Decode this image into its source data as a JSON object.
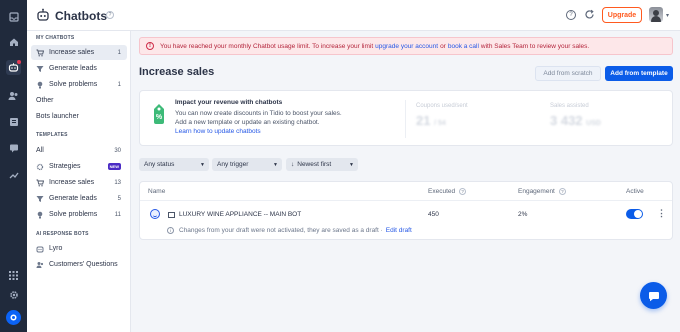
{
  "app": {
    "title": "Chatbots",
    "help_badge": "?"
  },
  "topbar": {
    "upgrade_label": "Upgrade",
    "help_label": "?"
  },
  "sidebar": {
    "my_chatbots_header": "MY CHATBOTS",
    "my_chatbots": [
      {
        "label": "Increase sales",
        "count": "1",
        "active": true
      },
      {
        "label": "Generate leads",
        "count": ""
      },
      {
        "label": "Solve problems",
        "count": "1"
      },
      {
        "label": "Other",
        "count": ""
      },
      {
        "label": "Bots launcher",
        "count": ""
      }
    ],
    "templates_header": "TEMPLATES",
    "templates": [
      {
        "label": "All",
        "count": "30"
      },
      {
        "label": "Strategies",
        "badge": "NEW"
      },
      {
        "label": "Increase sales",
        "count": "13"
      },
      {
        "label": "Generate leads",
        "count": "5"
      },
      {
        "label": "Solve problems",
        "count": "11"
      }
    ],
    "ai_header": "AI RESPONSE BOTS",
    "ai_items": [
      {
        "label": "Lyro"
      },
      {
        "label": "Customers' Questions"
      }
    ]
  },
  "alert": {
    "text_1": "You have reached your monthly Chatbot usage limit. To increase your limit",
    "link_1": "upgrade your account",
    "text_2": "or",
    "link_2": "book a call",
    "text_3": "with Sales Team to review your sales."
  },
  "main": {
    "title": "Increase sales",
    "add_scratch_label": "Add from scratch",
    "add_template_label": "Add from template"
  },
  "promo": {
    "heading": "Impact your revenue with chatbots",
    "line_1": "You can now create discounts in Tidio to boost your sales.",
    "line_2": "Add a new template or update an existing chatbot.",
    "link": "Learn how to update chatbots",
    "stat_1_label": "Coupons used/sent",
    "stat_1_value": "21",
    "stat_1_sub": "/ 54",
    "stat_2_label": "Sales assisted",
    "stat_2_value": "3 432",
    "stat_2_unit": "USD"
  },
  "filters": {
    "status": "Any status",
    "trigger": "Any trigger",
    "sort": "Newest first"
  },
  "table": {
    "headers": {
      "name": "Name",
      "executed": "Executed",
      "engagement": "Engagement",
      "active": "Active"
    },
    "rows": [
      {
        "name": "LUXURY WINE APPLIANCE -- MAIN BOT",
        "executed": "450",
        "engagement": "2%",
        "active": true,
        "note": "Changes from your draft were not activated, they are saved as a draft ·",
        "edit_label": "Edit draft"
      }
    ]
  },
  "colors": {
    "accent": "#0b5ce8",
    "upgrade": "#ff5a1f",
    "alert_bg": "#fde7e9",
    "rail": "#202a3c"
  }
}
